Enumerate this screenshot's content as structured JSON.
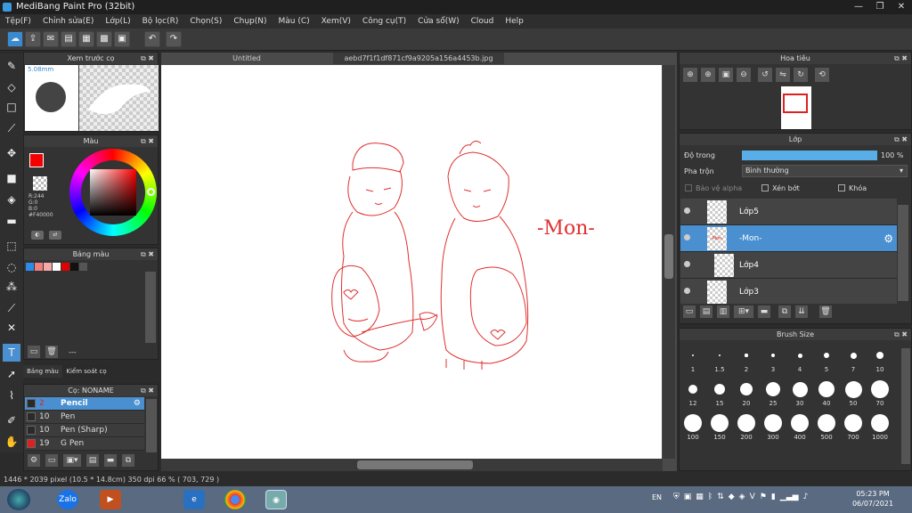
{
  "window": {
    "title": "MediBang Paint Pro (32bit)"
  },
  "menu": [
    "Tệp(F)",
    "Chỉnh sửa(E)",
    "Lớp(L)",
    "Bộ lọc(R)",
    "Chọn(S)",
    "Chụp(N)",
    "Màu (C)",
    "Xem(V)",
    "Công cụ(T)",
    "Cửa sổ(W)",
    "Cloud",
    "Help"
  ],
  "tabs": {
    "untitled": "Untitled",
    "file": "aebd7f1f1df871cf9a9205a156a4453b.jpg"
  },
  "brush_preview": {
    "title": "Xem trước cọ",
    "size": "5.08mm"
  },
  "color_panel": {
    "title": "Màu",
    "r": "R:244",
    "g": "G:0",
    "b": "B:0",
    "hex": "#F40000",
    "primary": "#f40000"
  },
  "palette": {
    "title": "Bảng màu",
    "value": "---",
    "colors": [
      "#2d8ae6",
      "#f08080",
      "#f5a8a8",
      "#ffffff",
      "#e00000",
      "#111111",
      "#555555"
    ]
  },
  "left_tabs": {
    "tab1": "Bảng màu",
    "tab2": "Kiểm soát cọ"
  },
  "brush_list": {
    "title": "Cọ: NONAME",
    "items": [
      {
        "size": "2",
        "name": "Pencil",
        "selected": true,
        "color": "#2a2a2a"
      },
      {
        "size": "10",
        "name": "Pen",
        "selected": false,
        "color": "#2a2a2a"
      },
      {
        "size": "10",
        "name": "Pen (Sharp)",
        "selected": false,
        "color": "#2a2a2a"
      },
      {
        "size": "19",
        "name": "G Pen",
        "selected": false,
        "color": "#e02020"
      }
    ]
  },
  "canvas_text": "-Mon-",
  "navigator": {
    "title": "Hoa tiêu"
  },
  "layers": {
    "title": "Lớp",
    "opacity_label": "Độ trong",
    "opacity_value": "100 %",
    "opacity": 1.0,
    "blend_label": "Pha trộn",
    "blend_value": "Bình thường",
    "protect_alpha": "Bảo vệ alpha",
    "clip": "Xén bớt",
    "lock": "Khóa",
    "items": [
      {
        "name": "Lớp5",
        "selected": false,
        "thumb": ""
      },
      {
        "name": "-Mon-",
        "selected": true,
        "thumb": "-Mon-"
      },
      {
        "name": "Lớp4",
        "selected": false,
        "thumb": ""
      },
      {
        "name": "Lớp3",
        "selected": false,
        "thumb": ""
      }
    ]
  },
  "brush_size": {
    "title": "Brush Size",
    "sizes": [
      "1",
      "1.5",
      "2",
      "3",
      "4",
      "5",
      "7",
      "10",
      "12",
      "15",
      "20",
      "25",
      "30",
      "40",
      "50",
      "70",
      "100",
      "150",
      "200",
      "300",
      "400",
      "500",
      "700",
      "1000"
    ]
  },
  "status": "1446 * 2039 pixel   (10.5 * 14.8cm)   350 dpi   66 %   ( 703, 729 )",
  "taskbar": {
    "lang": "EN",
    "time": "05:23 PM",
    "date": "06/07/2021",
    "zalo": "Zalo"
  }
}
